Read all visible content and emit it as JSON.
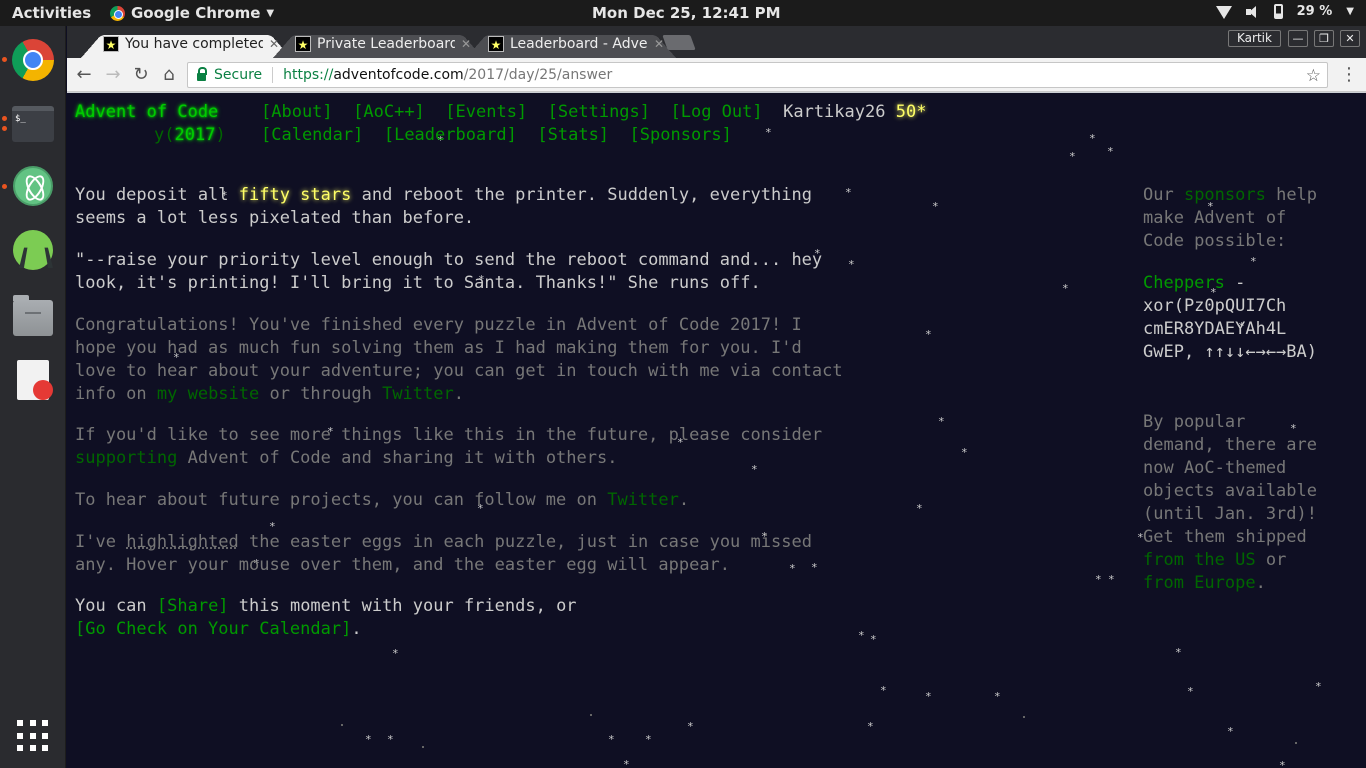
{
  "system": {
    "activities": "Activities",
    "app_menu": "Google Chrome",
    "clock": "Mon Dec 25, 12:41 PM",
    "battery": "29 %"
  },
  "browser": {
    "tabs": [
      {
        "title": "You have completed",
        "close": "✕"
      },
      {
        "title": "Private Leaderboard",
        "close": "✕"
      },
      {
        "title": "Leaderboard - Advent",
        "close": "✕"
      }
    ],
    "profile": "Kartik",
    "secure_label": "Secure",
    "url_scheme": "https://",
    "url_host": "adventofcode.com",
    "url_path": "/2017/day/25/answer"
  },
  "aoc": {
    "title": "Advent of Code",
    "year_prefix": "y(",
    "year": "2017",
    "year_suffix": ")",
    "nav1": [
      "[About]",
      "[AoC++]",
      "[Events]",
      "[Settings]",
      "[Log Out]"
    ],
    "nav2": [
      "[Calendar]",
      "[Leaderboard]",
      "[Stats]",
      "[Sponsors]"
    ],
    "user": "Kartikay26",
    "stars": "50*",
    "p1a": "You deposit all ",
    "p1_link": "fifty stars",
    "p1b": " and reboot the printer. Suddenly, everything",
    "p1c": "seems a lot less pixelated than before.",
    "p2a": "\"--raise your priority level enough to send the reboot command and... hey",
    "p2b": "look, it's printing! I'll bring it to Santa. Thanks!\" She runs off.",
    "p3a": "Congratulations! You've finished every puzzle in Advent of Code 2017! I",
    "p3b": "hope you had as much fun solving them as I had making them for you. I'd",
    "p3c": "love to hear about your adventure; you can get in touch with me via contact",
    "p3d1": "info on ",
    "p3d_link1": "my website",
    "p3d2": " or through ",
    "p3d_link2": "Twitter",
    "p3d3": ".",
    "p4a": "If you'd like to see more things like this in the future, please consider",
    "p4_link": "supporting",
    "p4b": " Advent of Code and sharing it with others.",
    "p5a": "To hear about future projects, you can follow me on ",
    "p5_link": "Twitter",
    "p5b": ".",
    "p6_prefix": "I've ",
    "p6_link": "highlighted",
    "p6a": " the easter eggs in each puzzle, just in case you missed",
    "p6b": "any. Hover your mouse over them, and the easter egg will appear.",
    "p7a": "You can ",
    "p7_share": "[Share]",
    "p7b": " this moment with your friends, or",
    "p7_calendar": "[Go Check on Your Calendar]",
    "p7c": "."
  },
  "sidebar": {
    "s1a": "Our ",
    "s1_link": "sponsors",
    "s1b": " help",
    "s1c": "make Advent of",
    "s1d": "Code possible:",
    "sponsor_name": "Cheppers",
    "sponsor_dash": " -",
    "sponsor_l1": "xor(Pz0pQUI7Ch",
    "sponsor_l2": "cmER8YDAEYAh4L",
    "sponsor_l3": "GwEP, ↑↑↓↓←→←→BA)",
    "m1": "By popular",
    "m2": "demand, there are",
    "m3": "now AoC-themed",
    "m4": "objects available",
    "m5": "(until Jan. 3rd)!",
    "m6": "Get them shipped",
    "m7_link": "from the US",
    "m7b": " or",
    "m8_link": "from Europe",
    "m8b": "."
  },
  "colors": {
    "background": "#0f0f23",
    "text": "#cccccc",
    "link_green": "#009900",
    "title_glow": "#00cc00",
    "star_gold": "#ffff66"
  }
}
